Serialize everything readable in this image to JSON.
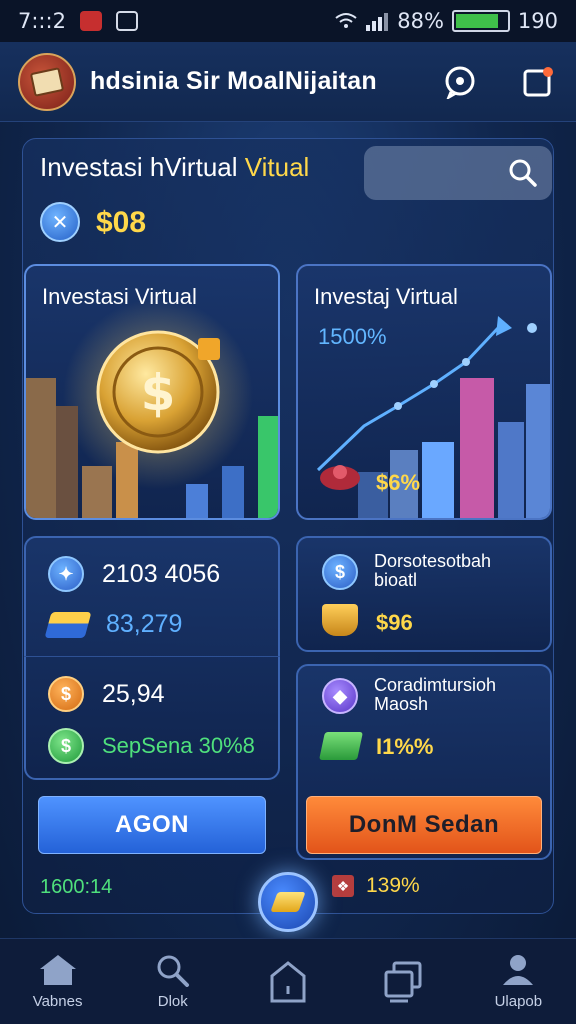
{
  "status_bar": {
    "time": "7:::2",
    "battery_text": "88%",
    "battery_level": 0.85,
    "right_value": "190"
  },
  "header": {
    "title": "hdsinia Sir MoalNijaitan"
  },
  "overview": {
    "title_part1": "Investasi hVirtual ",
    "title_part2": "Vitual",
    "balance": "$08"
  },
  "hero_cards": [
    {
      "label": "Investasi Virtual"
    },
    {
      "label": "Investaj Virtual",
      "stat_top": "1500%",
      "stat_bottom": "$6%"
    }
  ],
  "stats_card": {
    "row1": "2103 4056",
    "row2": "83,279",
    "row3": "25,94",
    "row4": "SepSena 30%8"
  },
  "side_cards": [
    {
      "title": "Dorsotesotbah\nbioatl",
      "value": "$96"
    },
    {
      "title": "Coradimtursioh\nMaosh",
      "value": "I1%%"
    }
  ],
  "buttons": {
    "primary": "AGON",
    "secondary": "DonM Sedan"
  },
  "footer": {
    "left_value": "1600:14",
    "right_value": "139%"
  },
  "nav": [
    {
      "label": "Vabnes",
      "icon": "home-icon"
    },
    {
      "label": "Dlok",
      "icon": "search-icon"
    },
    {
      "label": "",
      "icon": "house-outline-icon"
    },
    {
      "label": "",
      "icon": "windows-icon"
    },
    {
      "label": "Ulapob",
      "icon": "user-icon"
    }
  ],
  "colors": {
    "accent_yellow": "#ffd84a",
    "accent_blue": "#4f93ff",
    "accent_orange": "#ff8a3a",
    "accent_green": "#4fe07c",
    "background": "#10264d"
  }
}
